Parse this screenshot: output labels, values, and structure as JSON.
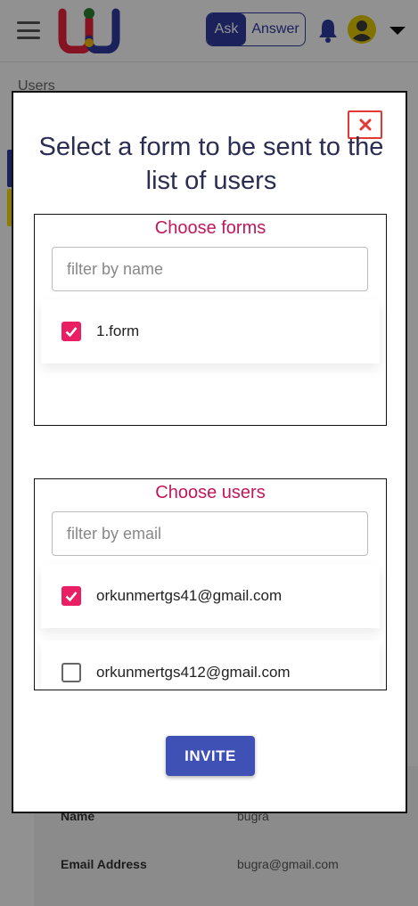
{
  "header": {
    "ask_label": "Ask",
    "answer_label": "Answer"
  },
  "breadcrumb": "Users",
  "profile": {
    "name_label": "Name",
    "name_value": "bugra",
    "email_label": "Email Address",
    "email_value": "bugra@gmail.com"
  },
  "modal": {
    "title": "Select a form to be sent to the list of users",
    "close_icon": "close-x-icon",
    "forms": {
      "heading": "Choose forms",
      "filter_placeholder": "filter by name",
      "items": [
        {
          "label": "1.form",
          "checked": true
        }
      ]
    },
    "users": {
      "heading": "Choose users",
      "filter_placeholder": "filter by email",
      "items": [
        {
          "label": "orkunmertgs41@gmail.com",
          "checked": true
        },
        {
          "label": "orkunmertgs412@gmail.com",
          "checked": false
        }
      ]
    },
    "invite_label": "INVITE"
  },
  "colors": {
    "primary": "#3f51b5",
    "accent": "#e91e63",
    "heading": "#c2185b",
    "title": "#2b2d52",
    "close": "#e53935",
    "brand_navy": "#2e3a9e"
  }
}
